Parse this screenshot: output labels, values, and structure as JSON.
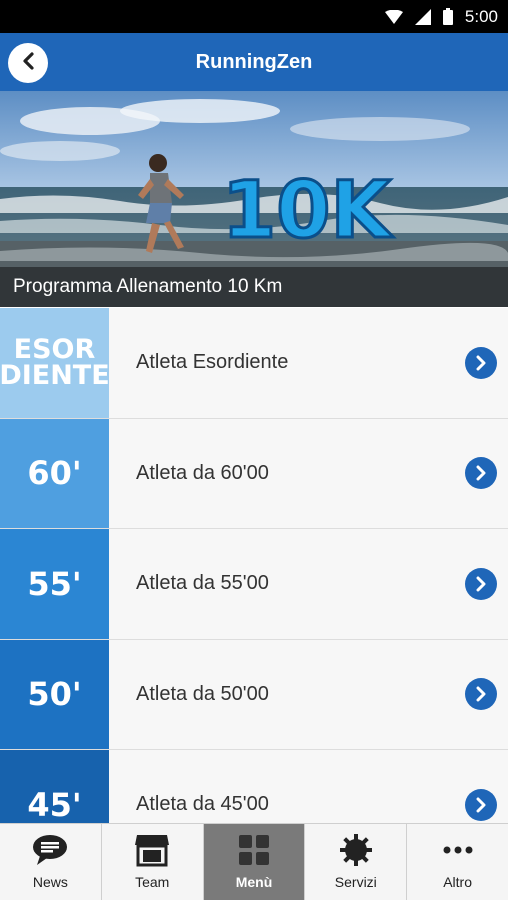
{
  "status_bar": {
    "time": "5:00"
  },
  "app_bar": {
    "title": "RunningZen"
  },
  "hero": {
    "caption": "Programma Allenamento 10 Km",
    "overlay_text": "10K"
  },
  "list": {
    "items": [
      {
        "badge_top": "ESOR",
        "badge_bottom": "DIENTE",
        "badge": "",
        "label": "Atleta Esordiente",
        "color": "#9ccbee"
      },
      {
        "badge": "60'",
        "label": "Atleta da 60'00",
        "color": "#4f9fe0"
      },
      {
        "badge": "55'",
        "label": "Atleta da 55'00",
        "color": "#2b86d3"
      },
      {
        "badge": "50'",
        "label": "Atleta da 50'00",
        "color": "#1d72c2"
      },
      {
        "badge": "45'",
        "label": "Atleta da 45'00",
        "color": "#1762ad"
      }
    ]
  },
  "tabs": [
    {
      "label": "News",
      "icon": "chat-icon"
    },
    {
      "label": "Team",
      "icon": "store-icon"
    },
    {
      "label": "Menù",
      "icon": "grid-icon",
      "active": true
    },
    {
      "label": "Servizi",
      "icon": "gear-icon"
    },
    {
      "label": "Altro",
      "icon": "more-icon"
    }
  ],
  "colors": {
    "primary": "#1f66b8",
    "active_tab": "#7a7a7a"
  }
}
